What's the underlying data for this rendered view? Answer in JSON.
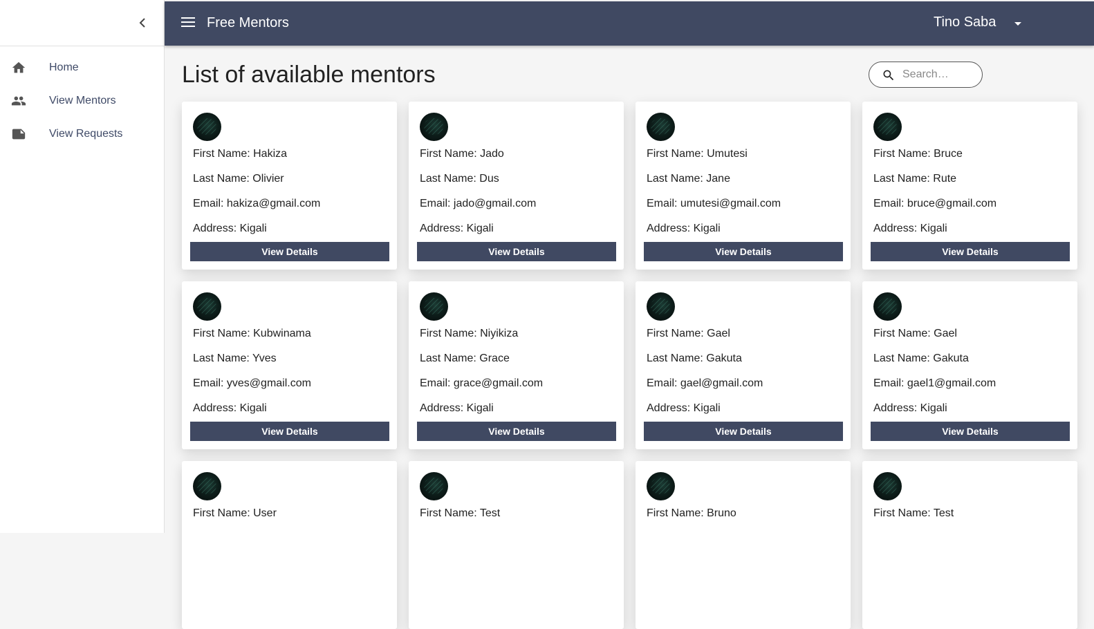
{
  "app": {
    "title": "Free Mentors",
    "user_name": "Tino Saba"
  },
  "sidebar": {
    "items": [
      {
        "label": "Home",
        "icon": "home-icon"
      },
      {
        "label": "View Mentors",
        "icon": "people-icon"
      },
      {
        "label": "View Requests",
        "icon": "note-icon"
      }
    ]
  },
  "page": {
    "title": "List of available mentors"
  },
  "search": {
    "placeholder": "Search…",
    "value": ""
  },
  "labels": {
    "first_name": "First Name: ",
    "last_name": "Last Name: ",
    "email": "Email: ",
    "address": "Address: ",
    "view_details": "View Details"
  },
  "mentors": [
    {
      "first_name": "Hakiza",
      "last_name": "Olivier",
      "email": "hakiza@gmail.com",
      "address": "Kigali"
    },
    {
      "first_name": "Jado",
      "last_name": "Dus",
      "email": "jado@gmail.com",
      "address": "Kigali"
    },
    {
      "first_name": "Umutesi",
      "last_name": "Jane",
      "email": "umutesi@gmail.com",
      "address": "Kigali"
    },
    {
      "first_name": "Bruce",
      "last_name": "Rute",
      "email": "bruce@gmail.com",
      "address": "Kigali"
    },
    {
      "first_name": "Kubwinama",
      "last_name": "Yves",
      "email": "yves@gmail.com",
      "address": "Kigali"
    },
    {
      "first_name": "Niyikiza",
      "last_name": "Grace",
      "email": "grace@gmail.com",
      "address": "Kigali"
    },
    {
      "first_name": "Gael",
      "last_name": "Gakuta",
      "email": "gael@gmail.com",
      "address": "Kigali"
    },
    {
      "first_name": "Gael",
      "last_name": "Gakuta",
      "email": "gael1@gmail.com",
      "address": "Kigali"
    },
    {
      "first_name": "User"
    },
    {
      "first_name": "Test"
    },
    {
      "first_name": "Bruno"
    },
    {
      "first_name": "Test"
    }
  ],
  "colors": {
    "primary": "#404962",
    "nav_text": "#3f4a67",
    "background": "#f5f5f5"
  }
}
